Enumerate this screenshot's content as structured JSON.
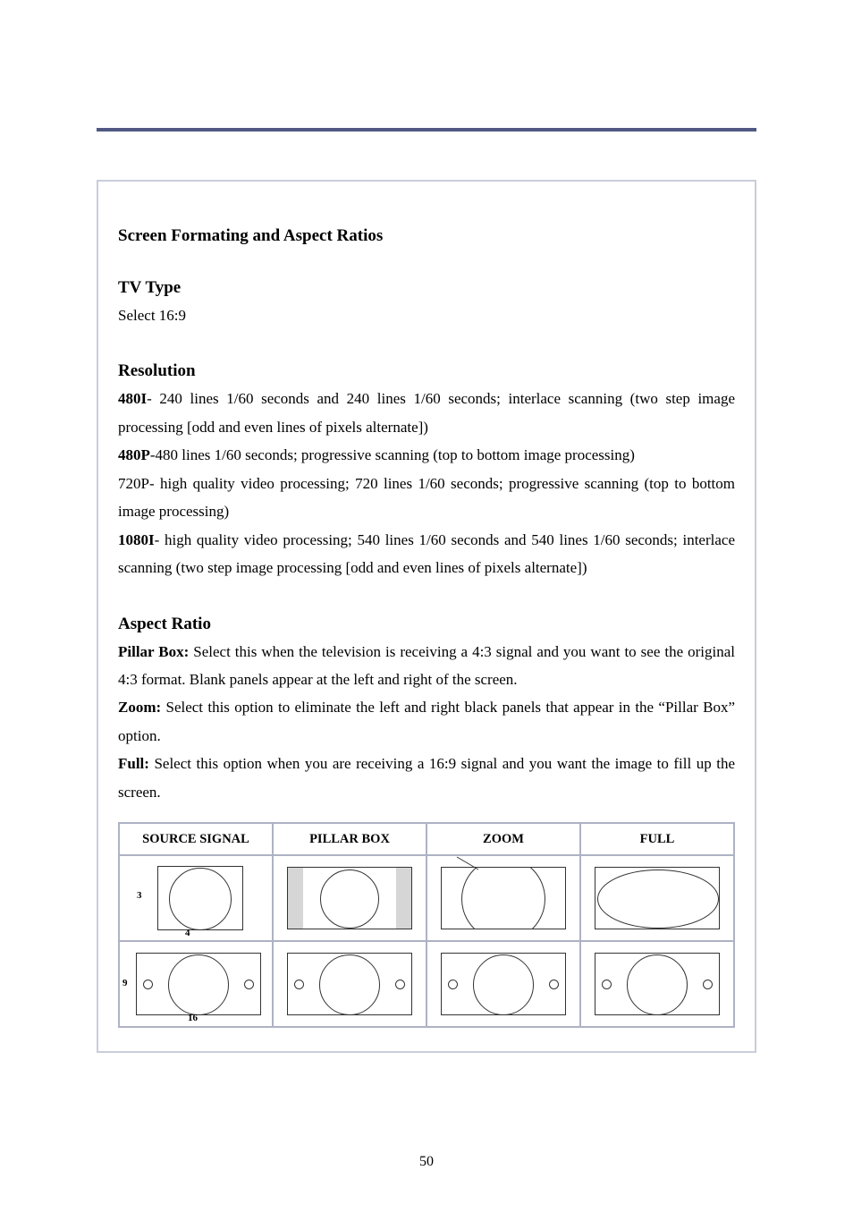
{
  "page": {
    "number": "50",
    "section_title": "Screen Formating and Aspect Ratios"
  },
  "tv_type": {
    "heading": "TV Type",
    "text": "Select 16:9"
  },
  "resolution": {
    "heading": "Resolution",
    "r480i_label": "480I",
    "r480i_text": "- 240 lines 1/60 seconds and 240 lines 1/60 seconds; interlace scanning (two step image processing [odd and even lines of pixels alternate])",
    "r480p_label": "480P",
    "r480p_text": "-480 lines 1/60 seconds; progressive scanning (top to bottom image processing)",
    "r720p_text": "720P- high quality video processing; 720 lines 1/60 seconds; progressive scanning (top to bottom image processing)",
    "r1080i_label": "1080I",
    "r1080i_text": "- high quality video processing; 540 lines 1/60 seconds and 540 lines 1/60 seconds; interlace scanning (two step image processing [odd and even lines of pixels alternate])"
  },
  "aspect_ratio": {
    "heading": "Aspect Ratio",
    "pillar_label": "Pillar Box:",
    "pillar_text": " Select this when the television is receiving a 4:3 signal and you want to see the original 4:3 format. Blank panels appear at the left and right of the screen.",
    "zoom_label": "Zoom:",
    "zoom_text": " Select this option to eliminate the left and right black panels that appear in the “Pillar Box” option.",
    "full_label": "Full:",
    "full_text": " Select this option when you are receiving a 16:9 signal and you want the image to fill up the screen."
  },
  "table": {
    "headers": [
      "SOURCE SIGNAL",
      "PILLAR BOX",
      "ZOOM",
      "FULL"
    ],
    "dim_3": "3",
    "dim_4": "4",
    "dim_9": "9",
    "dim_16": "16"
  }
}
